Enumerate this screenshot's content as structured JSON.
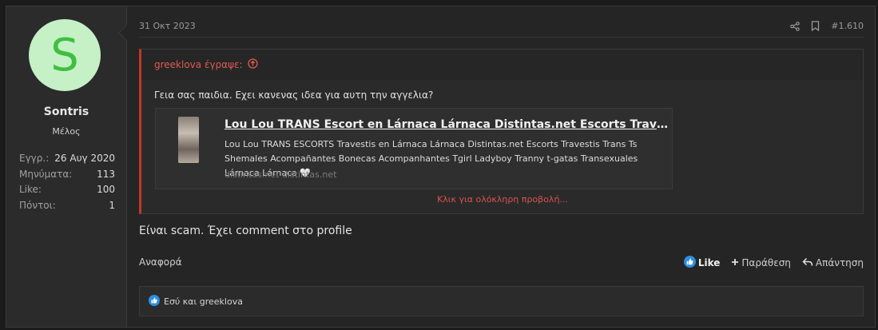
{
  "user": {
    "avatar_letter": "S",
    "name": "Sontris",
    "title": "Μέλος",
    "stats": [
      {
        "label": "Εγγρ.:",
        "value": "26 Αυγ 2020"
      },
      {
        "label": "Μηνύματα:",
        "value": "113"
      },
      {
        "label": "Like:",
        "value": "100"
      },
      {
        "label": "Πόντοι:",
        "value": "1"
      }
    ]
  },
  "post": {
    "date": "31 Οκτ 2023",
    "number": "#1.610",
    "quote": {
      "author_line": "greeklova έγραψε:",
      "text": "Γεια σας παιδια. Εχει κανενας ιδεα για αυτη την αγγελια?",
      "unfurl": {
        "title": "Lou Lou TRANS Escort en Lárnaca Lárnaca Distintas.net Escorts Travestis Trans Ts Shemales",
        "description": "Lou Lou TRANS ESCORTS Travestis en Lárnaca Lárnaca Distintas.net Escorts Travestis Trans Ts Shemales Acompañantes Bonecas Acompanhantes Tgirl Ladyboy Tranny t-gatas Transexuales Lárnaca Lárnaca 🤍",
        "domain": "distintas.net distintas.net"
      },
      "expand_label": "Κλικ για ολόκληρη προβολή..."
    },
    "content": "Είναι scam. Έχει comment στο profile",
    "actions": {
      "report": "Αναφορά",
      "like": "Like",
      "quote": "Παράθεση",
      "reply": "Απάντηση"
    },
    "reactions_text": "Εσύ και greeklova"
  },
  "colors": {
    "accent_red": "#d9534f",
    "like_blue": "#2d8fe0",
    "avatar_bg": "#c6f0c6",
    "avatar_fg": "#3fbf3f"
  },
  "icons": [
    "share-icon",
    "bookmark-icon",
    "arrow-up-circle-icon",
    "thumbs-up-icon",
    "plus-icon",
    "reply-icon"
  ]
}
